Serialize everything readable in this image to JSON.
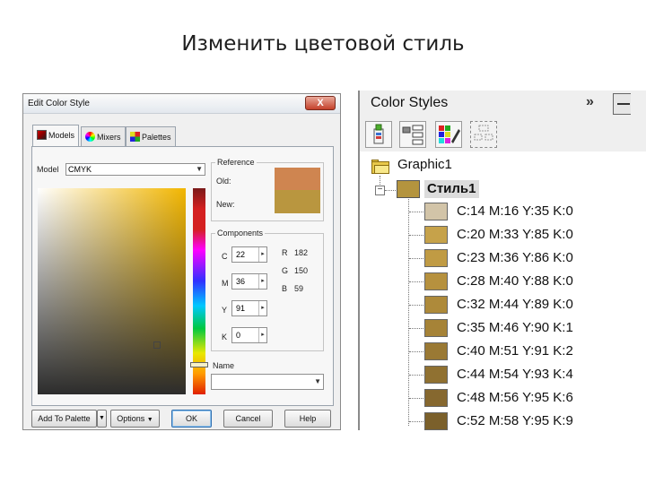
{
  "slide_title": "Изменить цветовой стиль",
  "dialog": {
    "title": "Edit Color Style",
    "close_label": "X",
    "tabs": [
      {
        "label": "Models",
        "active": true,
        "icon": "models-icon"
      },
      {
        "label": "Mixers",
        "active": false,
        "icon": "mixers-icon"
      },
      {
        "label": "Palettes",
        "active": false,
        "icon": "palettes-icon"
      }
    ],
    "model_label": "Model",
    "model_value": "CMYK",
    "reference": {
      "title": "Reference",
      "old_label": "Old:",
      "new_label": "New:",
      "old_color": "#cf8550",
      "new_color": "#b9963f"
    },
    "components": {
      "title": "Components",
      "cmyk": [
        {
          "label": "C",
          "value": "22"
        },
        {
          "label": "M",
          "value": "36"
        },
        {
          "label": "Y",
          "value": "91"
        },
        {
          "label": "K",
          "value": "0"
        }
      ],
      "rgb": [
        {
          "label": "R",
          "value": "182"
        },
        {
          "label": "G",
          "value": "150"
        },
        {
          "label": "B",
          "value": "59"
        }
      ]
    },
    "name_label": "Name",
    "buttons": {
      "add_to_palette": "Add To Palette",
      "options": "Options",
      "ok": "OK",
      "cancel": "Cancel",
      "help": "Help"
    },
    "colors": {
      "hue_color": "#f2b600"
    }
  },
  "docker": {
    "title": "Color Styles",
    "chevrons": "»",
    "toolbar_icons": [
      "new-style-icon",
      "new-child-icon",
      "convert-palette-icon",
      "edit-icon",
      "arrange-icon"
    ],
    "tree": {
      "root_label": "Graphic1",
      "style": {
        "label": "Стиль1",
        "color": "#b4943e"
      },
      "children": [
        {
          "label": "C:14 M:16 Y:35 K:0",
          "color": "#d2c4a8"
        },
        {
          "label": "C:20 M:33 Y:85 K:0",
          "color": "#c6a24a"
        },
        {
          "label": "C:23 M:36 Y:86 K:0",
          "color": "#c09b44"
        },
        {
          "label": "C:28 M:40 Y:88 K:0",
          "color": "#b6913e"
        },
        {
          "label": "C:32 M:44 Y:89 K:0",
          "color": "#ae8a3a"
        },
        {
          "label": "C:35 M:46 Y:90 K:1",
          "color": "#a68337"
        },
        {
          "label": "C:40 M:51 Y:91 K:2",
          "color": "#9a7934"
        },
        {
          "label": "C:44 M:54 Y:93 K:4",
          "color": "#907131"
        },
        {
          "label": "C:48 M:56 Y:95 K:6",
          "color": "#86682f"
        },
        {
          "label": "C:52 M:58 Y:95 K:9",
          "color": "#7b602b"
        }
      ]
    }
  }
}
